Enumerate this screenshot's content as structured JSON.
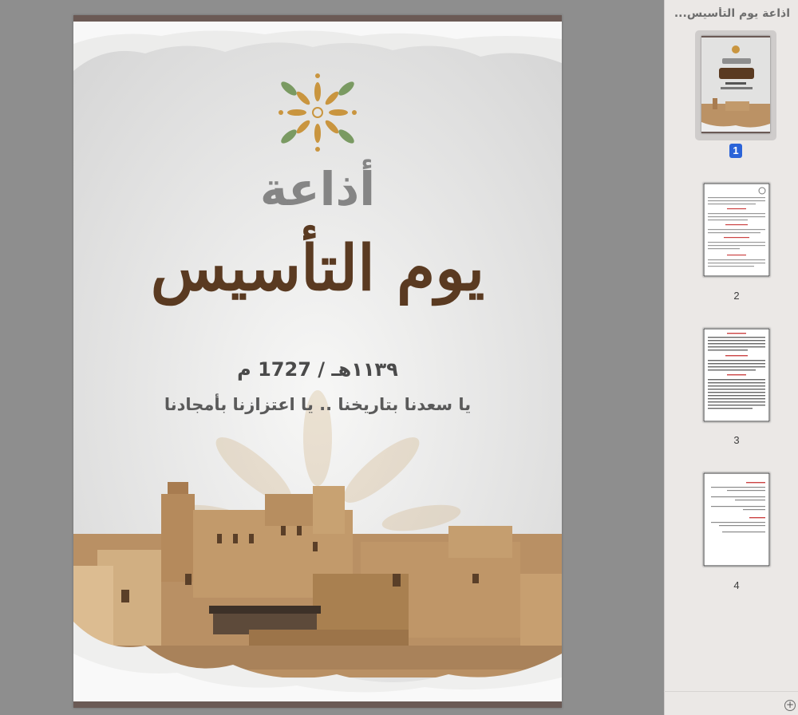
{
  "document": {
    "cover": {
      "heading": "أذاعة",
      "title": "يوم التأسيس",
      "date": "١١٣٩هـ / 1727 م",
      "slogan": "يا سعدنا بتاريخنا .. يا اعتزازنا بأمجادنا"
    }
  },
  "sidebar": {
    "title": "اذاعة يوم التأسيس...",
    "pages": [
      {
        "number": "1",
        "selected": true
      },
      {
        "number": "2",
        "selected": false
      },
      {
        "number": "3",
        "selected": false
      },
      {
        "number": "4",
        "selected": false
      }
    ],
    "add_label": "+"
  },
  "colors": {
    "title_brown": "#5a3a21",
    "heading_gray": "#858585",
    "selection_blue": "#2b63d8",
    "page_frame": "#6b5a55"
  }
}
